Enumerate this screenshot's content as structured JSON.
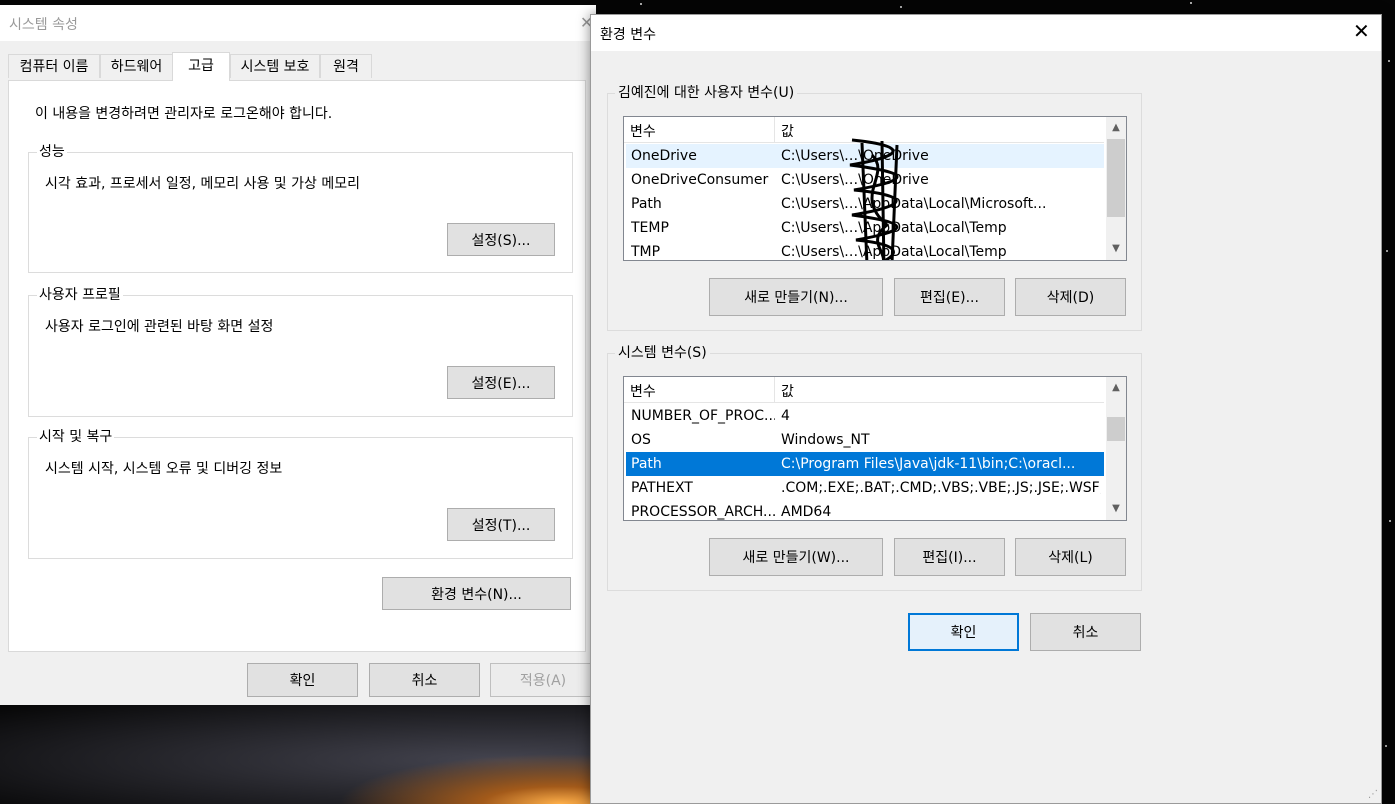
{
  "sysprops": {
    "title": "시스템 속성",
    "close": "✕",
    "tabs": [
      "컴퓨터 이름",
      "하드웨어",
      "고급",
      "시스템 보호",
      "원격"
    ],
    "admin_note": "이 내용을 변경하려면 관리자로 로그온해야 합니다.",
    "performance": {
      "legend": "성능",
      "desc": "시각 효과, 프로세서 일정, 메모리 사용 및 가상 메모리",
      "button": "설정(S)..."
    },
    "user_profiles": {
      "legend": "사용자 프로필",
      "desc": "사용자 로그인에 관련된 바탕 화면 설정",
      "button": "설정(E)..."
    },
    "startup": {
      "legend": "시작 및 복구",
      "desc": "시스템 시작, 시스템 오류 및 디버깅 정보",
      "button": "설정(T)..."
    },
    "env_button": "환경 변수(N)...",
    "ok": "확인",
    "cancel": "취소",
    "apply": "적용(A)"
  },
  "envvars": {
    "title": "환경 변수",
    "close": "✕",
    "user": {
      "legend": "김예진에 대한 사용자 변수(U)",
      "col_var": "변수",
      "col_val": "값",
      "rows": [
        {
          "name": "OneDrive",
          "value": "C:\\Users\\…\\OneDrive"
        },
        {
          "name": "OneDriveConsumer",
          "value": "C:\\Users\\…\\OneDrive"
        },
        {
          "name": "Path",
          "value": "C:\\Users\\…\\AppData\\Local\\Microsoft..."
        },
        {
          "name": "TEMP",
          "value": "C:\\Users\\…\\AppData\\Local\\Temp"
        },
        {
          "name": "TMP",
          "value": "C:\\Users\\…\\AppData\\Local\\Temp"
        }
      ],
      "new_btn": "새로 만들기(N)...",
      "edit_btn": "편집(E)...",
      "delete_btn": "삭제(D)"
    },
    "system": {
      "legend": "시스템 변수(S)",
      "col_var": "변수",
      "col_val": "값",
      "rows": [
        {
          "name": "NUMBER_OF_PROC...",
          "value": "4"
        },
        {
          "name": "OS",
          "value": "Windows_NT"
        },
        {
          "name": "Path",
          "value": "C:\\Program Files\\Java\\jdk-11\\bin;C:\\oracl..."
        },
        {
          "name": "PATHEXT",
          "value": ".COM;.EXE;.BAT;.CMD;.VBS;.VBE;.JS;.JSE;.WSF;..."
        },
        {
          "name": "PROCESSOR_ARCH...",
          "value": "AMD64"
        }
      ],
      "new_btn": "새로 만들기(W)...",
      "edit_btn": "편집(I)...",
      "delete_btn": "삭제(L)"
    },
    "ok": "확인",
    "cancel": "취소"
  },
  "colors": {
    "accent": "#0078d7",
    "hover_row": "#e5f3ff",
    "window_bg": "#f0f0f0"
  }
}
